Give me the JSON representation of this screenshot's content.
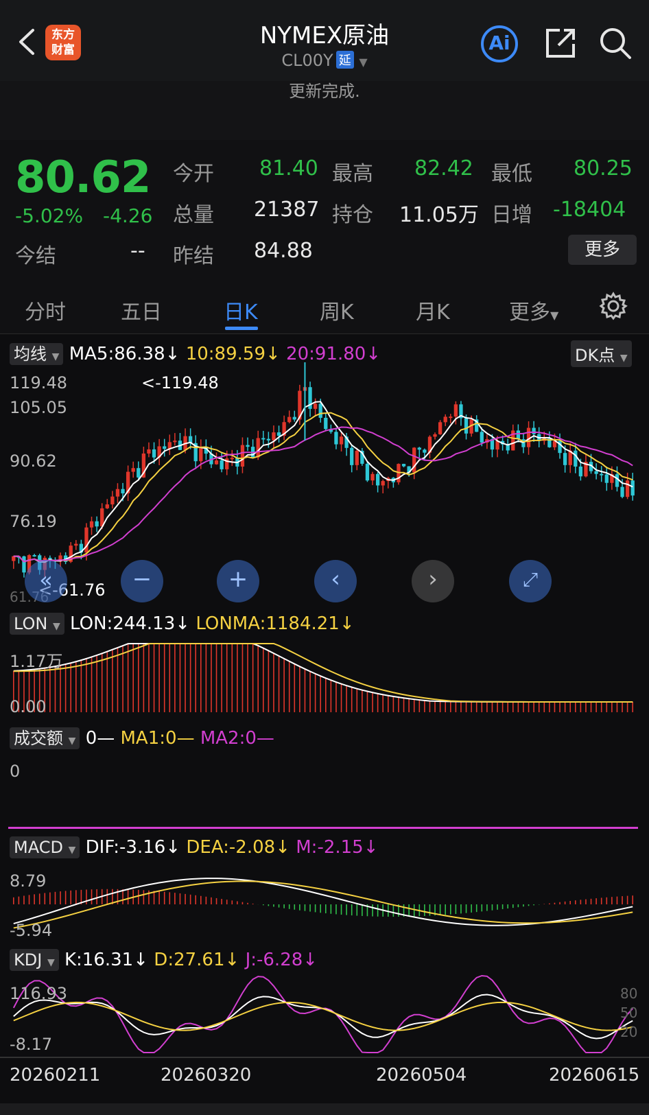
{
  "header": {
    "title": "NYMEX原油",
    "code": "CL00Y",
    "delay_badge": "延",
    "ai_label": "Ai",
    "logo_line1": "东方",
    "logo_line2": "财富"
  },
  "status": {
    "update": "更新完成."
  },
  "quote": {
    "price": "80.62",
    "change_pct": "-5.02%",
    "change": "-4.26",
    "open_label": "今开",
    "open": "81.40",
    "high_label": "最高",
    "high": "82.42",
    "low_label": "最低",
    "low": "80.25",
    "volume_label": "总量",
    "volume": "21387",
    "oi_label": "持仓",
    "oi": "11.05万",
    "daily_inc_label": "日增",
    "daily_inc": "-18404",
    "settle_label": "今结",
    "settle": "--",
    "prev_settle_label": "昨结",
    "prev_settle": "84.88",
    "more": "更多"
  },
  "tabs": [
    {
      "label": "分时"
    },
    {
      "label": "五日"
    },
    {
      "label": "日K"
    },
    {
      "label": "周K"
    },
    {
      "label": "月K"
    },
    {
      "label": "更多"
    }
  ],
  "colors": {
    "up": "#e0362b",
    "down": "#2ec7d6",
    "green": "#30c04a",
    "ma5": "#ffffff",
    "ma10": "#f5d142",
    "ma20": "#d23fd0",
    "accent": "#3d8af7"
  },
  "ma": {
    "selector": "均线",
    "ma5": "MA5:86.38",
    "ma10": "10:89.59",
    "ma20": "20:91.80",
    "dk": "DK点",
    "arrow": "↓"
  },
  "kline": {
    "y_labels": [
      "119.48",
      "105.05",
      "90.62",
      "76.19"
    ],
    "max_note": "<-119.48",
    "min_note": "<-61.76",
    "min_axis": "61.76",
    "series_ylim": [
      58,
      123
    ]
  },
  "lon": {
    "selector": "LON",
    "lon": "LON:244.13",
    "lonma": "LONMA:1184.21",
    "y_top": "1.17万",
    "y_bottom": "0.00"
  },
  "amount": {
    "selector": "成交额",
    "v0": "0—",
    "ma1": "MA1:0—",
    "ma2": "MA2:0—",
    "y_label": "0"
  },
  "macd": {
    "selector": "MACD",
    "dif": "DIF:-3.16",
    "dea": "DEA:-2.08",
    "m": "M:-2.15",
    "y_top": "8.79",
    "y_bottom": "-5.94"
  },
  "kdj": {
    "selector": "KDJ",
    "k": "K:16.31",
    "d": "D:27.61",
    "j": "J:-6.28",
    "y_top": "116.93",
    "y_bottom": "-8.17",
    "r80": "80",
    "r50": "50",
    "r20": "20"
  },
  "dates": [
    "20260211",
    "20260320",
    "20260504",
    "20260615"
  ],
  "chart_data": {
    "type": "candlestick",
    "title": "NYMEX原油",
    "y_ticks": [
      119.48,
      105.05,
      90.62,
      76.19
    ],
    "ylim": [
      58,
      123
    ],
    "x_labels": [
      "20260211",
      "20260320",
      "20260504",
      "20260615"
    ],
    "indicators": {
      "MA5": 86.38,
      "MA10": 89.59,
      "MA20": 91.8,
      "LON": 244.13,
      "LONMA": 1184.21,
      "DIF": -3.16,
      "DEA": -2.08,
      "M": -2.15,
      "K": 16.31,
      "D": 27.61,
      "J": -6.28
    },
    "high_marker": 119.48,
    "low_marker": 61.76
  }
}
